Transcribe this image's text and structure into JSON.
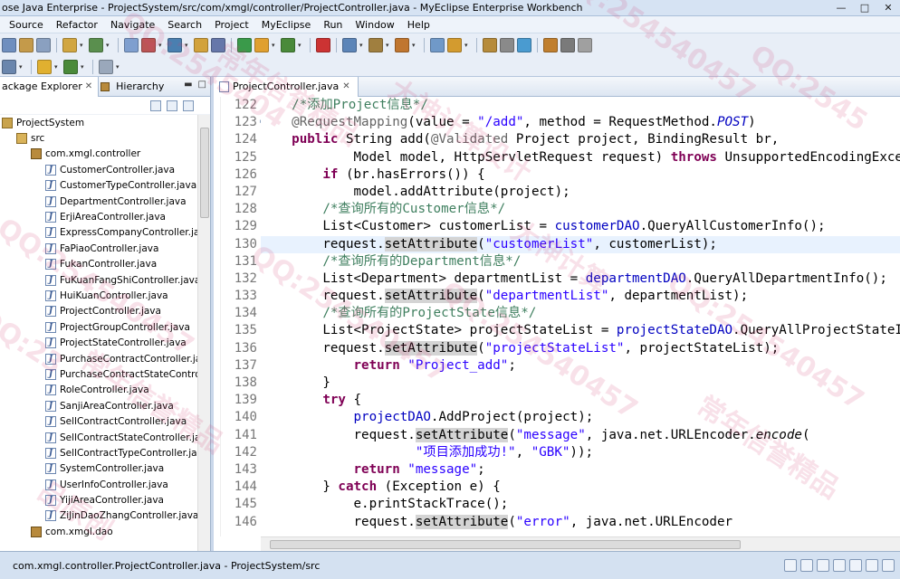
{
  "window": {
    "title": "ose Java Enterprise - ProjectSystem/src/com/xmgl/controller/ProjectController.java - MyEclipse Enterprise Workbench",
    "minimize": "—",
    "maximize": "□",
    "close": "✕"
  },
  "menu": [
    "Source",
    "Refactor",
    "Navigate",
    "Search",
    "Project",
    "MyEclipse",
    "Run",
    "Window",
    "Help"
  ],
  "package_explorer": {
    "tab_label": "ackage Explorer",
    "hierarchy_label": "Hierarchy",
    "close_glyph": "✕",
    "tree": [
      {
        "label": "ProjectSystem",
        "type": "project",
        "indent": 0
      },
      {
        "label": "src",
        "type": "src",
        "indent": 1
      },
      {
        "label": "com.xmgl.controller",
        "type": "package",
        "indent": 2
      },
      {
        "label": "CustomerController.java",
        "type": "java",
        "indent": 3
      },
      {
        "label": "CustomerTypeController.java",
        "type": "java",
        "indent": 3
      },
      {
        "label": "DepartmentController.java",
        "type": "java",
        "indent": 3
      },
      {
        "label": "ErjiAreaController.java",
        "type": "java",
        "indent": 3
      },
      {
        "label": "ExpressCompanyController.jav",
        "type": "java",
        "indent": 3
      },
      {
        "label": "FaPiaoController.java",
        "type": "java",
        "indent": 3
      },
      {
        "label": "FukanController.java",
        "type": "java",
        "indent": 3
      },
      {
        "label": "FuKuanFangShiController.java",
        "type": "java",
        "indent": 3
      },
      {
        "label": "HuiKuanController.java",
        "type": "java",
        "indent": 3
      },
      {
        "label": "ProjectController.java",
        "type": "java",
        "indent": 3
      },
      {
        "label": "ProjectGroupController.java",
        "type": "java",
        "indent": 3
      },
      {
        "label": "ProjectStateController.java",
        "type": "java",
        "indent": 3
      },
      {
        "label": "PurchaseContractController.ja",
        "type": "java",
        "indent": 3
      },
      {
        "label": "PurchaseContractStateControll",
        "type": "java",
        "indent": 3
      },
      {
        "label": "RoleController.java",
        "type": "java",
        "indent": 3
      },
      {
        "label": "SanjiAreaController.java",
        "type": "java",
        "indent": 3
      },
      {
        "label": "SellContractController.java",
        "type": "java",
        "indent": 3
      },
      {
        "label": "SellContractStateController.jav",
        "type": "java",
        "indent": 3
      },
      {
        "label": "SellContractTypeController.jav",
        "type": "java",
        "indent": 3
      },
      {
        "label": "SystemController.java",
        "type": "java",
        "indent": 3
      },
      {
        "label": "UserInfoController.java",
        "type": "java",
        "indent": 3
      },
      {
        "label": "YijiAreaController.java",
        "type": "java",
        "indent": 3
      },
      {
        "label": "ZiJinDaoZhangController.java",
        "type": "java",
        "indent": 3
      },
      {
        "label": "com.xmgl.dao",
        "type": "package",
        "indent": 2
      }
    ]
  },
  "editor": {
    "tab_label": "ProjectController.java",
    "close_glyph": "✕",
    "highlight_line": 130,
    "lines": [
      {
        "n": "122",
        "tokens": [
          [
            "    ",
            ""
          ],
          [
            "/*添加Project信息*/",
            "cm"
          ]
        ]
      },
      {
        "n": "123",
        "fold": true,
        "tokens": [
          [
            "    ",
            ""
          ],
          [
            "@RequestMapping",
            "an"
          ],
          [
            "(value = ",
            ""
          ],
          [
            "\"/add\"",
            "st"
          ],
          [
            ", method = RequestMethod.",
            ""
          ],
          [
            "POST",
            "fd it"
          ],
          [
            ")",
            ""
          ]
        ]
      },
      {
        "n": "124",
        "tokens": [
          [
            "    ",
            ""
          ],
          [
            "public",
            "kw"
          ],
          [
            " String add(",
            ""
          ],
          [
            "@Validated",
            "an"
          ],
          [
            " Project project, BindingResult br,",
            ""
          ]
        ]
      },
      {
        "n": "125",
        "tokens": [
          [
            "            Model model, HttpServletRequest request) ",
            ""
          ],
          [
            "throws",
            "kw"
          ],
          [
            " UnsupportedEncodingException {",
            ""
          ]
        ]
      },
      {
        "n": "126",
        "tokens": [
          [
            "        ",
            ""
          ],
          [
            "if",
            "kw"
          ],
          [
            " (br.hasErrors()) {",
            ""
          ]
        ]
      },
      {
        "n": "127",
        "tokens": [
          [
            "            model.addAttribute(project);",
            ""
          ]
        ]
      },
      {
        "n": "128",
        "tokens": [
          [
            "        ",
            ""
          ],
          [
            "/*查询所有的Customer信息*/",
            "cm"
          ]
        ]
      },
      {
        "n": "129",
        "tokens": [
          [
            "        List<Customer> customerList = ",
            ""
          ],
          [
            "customerDAO",
            "fd"
          ],
          [
            ".QueryAllCustomerInfo();",
            ""
          ]
        ]
      },
      {
        "n": "130",
        "tokens": [
          [
            "        request.",
            ""
          ],
          [
            "setAttribute",
            "hlm"
          ],
          [
            "(",
            ""
          ],
          [
            "\"customerList\"",
            "st"
          ],
          [
            ", customerList);",
            ""
          ]
        ]
      },
      {
        "n": "131",
        "tokens": [
          [
            "        ",
            ""
          ],
          [
            "/*查询所有的Department信息*/",
            "cm"
          ]
        ]
      },
      {
        "n": "132",
        "tokens": [
          [
            "        List<Department> departmentList = ",
            ""
          ],
          [
            "departmentDAO",
            "fd"
          ],
          [
            ".QueryAllDepartmentInfo();",
            ""
          ]
        ]
      },
      {
        "n": "133",
        "tokens": [
          [
            "        request.",
            ""
          ],
          [
            "setAttribute",
            "hlm"
          ],
          [
            "(",
            ""
          ],
          [
            "\"departmentList\"",
            "st"
          ],
          [
            ", departmentList);",
            ""
          ]
        ]
      },
      {
        "n": "134",
        "tokens": [
          [
            "        ",
            ""
          ],
          [
            "/*查询所有的ProjectState信息*/",
            "cm"
          ]
        ]
      },
      {
        "n": "135",
        "tokens": [
          [
            "        List<ProjectState> projectStateList = ",
            ""
          ],
          [
            "projectStateDAO",
            "fd"
          ],
          [
            ".QueryAllProjectStateInfo();",
            ""
          ]
        ]
      },
      {
        "n": "136",
        "tokens": [
          [
            "        request.",
            ""
          ],
          [
            "setAttribute",
            "hlm"
          ],
          [
            "(",
            ""
          ],
          [
            "\"projectStateList\"",
            "st"
          ],
          [
            ", projectStateList);",
            ""
          ]
        ]
      },
      {
        "n": "137",
        "tokens": [
          [
            "            ",
            ""
          ],
          [
            "return",
            "kw"
          ],
          [
            " ",
            ""
          ],
          [
            "\"Project_add\"",
            "st"
          ],
          [
            ";",
            ""
          ]
        ]
      },
      {
        "n": "138",
        "tokens": [
          [
            "        }",
            ""
          ]
        ]
      },
      {
        "n": "139",
        "tokens": [
          [
            "        ",
            ""
          ],
          [
            "try",
            "kw"
          ],
          [
            " {",
            ""
          ]
        ]
      },
      {
        "n": "140",
        "tokens": [
          [
            "            ",
            ""
          ],
          [
            "projectDAO",
            "fd"
          ],
          [
            ".AddProject(project);",
            ""
          ]
        ]
      },
      {
        "n": "141",
        "tokens": [
          [
            "            request.",
            ""
          ],
          [
            "setAttribute",
            "hlm"
          ],
          [
            "(",
            ""
          ],
          [
            "\"message\"",
            "st"
          ],
          [
            ", java.net.URLEncoder.",
            ""
          ],
          [
            "encode",
            "it"
          ],
          [
            "(",
            ""
          ]
        ]
      },
      {
        "n": "142",
        "tokens": [
          [
            "                    ",
            ""
          ],
          [
            "\"项目添加成功!\"",
            "st"
          ],
          [
            ", ",
            ""
          ],
          [
            "\"GBK\"",
            "st"
          ],
          [
            "));",
            ""
          ]
        ]
      },
      {
        "n": "143",
        "tokens": [
          [
            "            ",
            ""
          ],
          [
            "return",
            "kw"
          ],
          [
            " ",
            ""
          ],
          [
            "\"message\"",
            "st"
          ],
          [
            ";",
            ""
          ]
        ]
      },
      {
        "n": "144",
        "tokens": [
          [
            "        } ",
            ""
          ],
          [
            "catch",
            "kw"
          ],
          [
            " (Exception e) {",
            ""
          ]
        ]
      },
      {
        "n": "145",
        "tokens": [
          [
            "            e.printStackTrace();",
            ""
          ]
        ]
      },
      {
        "n": "146",
        "tokens": [
          [
            "            request.",
            ""
          ],
          [
            "setAttribute",
            "hlm"
          ],
          [
            "(",
            ""
          ],
          [
            "\"error\"",
            "st"
          ],
          [
            ", java.net.URLEncoder",
            ""
          ]
        ]
      }
    ]
  },
  "status": {
    "text": "com.xmgl.controller.ProjectController.java - ProjectSystem/src"
  },
  "watermark": {
    "texts": [
      "QQ:2545404",
      "常年信誉精品",
      "大神计算设计",
      "QQ:254540457",
      "QQ:2545",
      "QQ:254540457",
      "常年信誉精品",
      "QQ:254540457",
      "QQ:254540457",
      "大神计算",
      "QQ:254540457",
      "常年信誉精品",
      "品原创",
      "QQ:23"
    ]
  },
  "colors": {
    "keyword": "#7f0055",
    "comment": "#3f7f5f",
    "string": "#2a00ff",
    "field": "#0000c0",
    "current_line": "#e8f2fe",
    "watermark": "#d24678"
  }
}
